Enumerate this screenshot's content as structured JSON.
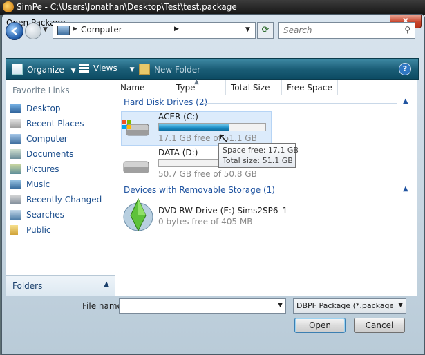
{
  "app": {
    "title": "SimPe - C:\\Users\\Jonathan\\Desktop\\Test\\test.package"
  },
  "dialog": {
    "title": "Open Package",
    "close_label": "x"
  },
  "address": {
    "path": "Computer",
    "search_placeholder": "Search"
  },
  "toolbar": {
    "organize": "Organize",
    "views": "Views",
    "new_folder": "New Folder",
    "help": "?"
  },
  "navpane": {
    "header": "Favorite Links",
    "items": [
      {
        "label": "Desktop",
        "icon": "desktop-icon"
      },
      {
        "label": "Recent Places",
        "icon": "recent-places-icon"
      },
      {
        "label": "Computer",
        "icon": "computer-icon"
      },
      {
        "label": "Documents",
        "icon": "documents-icon"
      },
      {
        "label": "Pictures",
        "icon": "pictures-icon"
      },
      {
        "label": "Music",
        "icon": "music-icon"
      },
      {
        "label": "Recently Changed",
        "icon": "recently-changed-icon"
      },
      {
        "label": "Searches",
        "icon": "searches-icon"
      },
      {
        "label": "Public",
        "icon": "public-folder-icon"
      }
    ],
    "folders": "Folders"
  },
  "columns": [
    "Name",
    "Type",
    "Total Size",
    "Free Space"
  ],
  "groups": {
    "hdd": "Hard Disk Drives (2)",
    "removable": "Devices with Removable Storage (1)"
  },
  "drives": [
    {
      "name": "ACER (C:)",
      "free_text": "17.1 GB free of 51.1 GB",
      "used_fraction": 0.665
    },
    {
      "name": "DATA (D:)",
      "free_text": "50.7 GB free of 50.8 GB",
      "used_fraction": 0.002
    },
    {
      "name": "DVD RW Drive (E:) Sims2SP6_1",
      "free_text": "0 bytes free of 405 MB"
    }
  ],
  "tooltip": {
    "space_free": "Space free: 17.1 GB",
    "total_size": "Total size: 51.1 GB"
  },
  "bottom": {
    "file_name_label": "File name:",
    "file_name_value": "",
    "file_type": "DBPF Package (*.package;*.",
    "open": "Open",
    "cancel": "Cancel"
  },
  "colors": {
    "toolbar": "#1b5e77",
    "link": "#1a4d8c",
    "bar_fill": "#1c8fc7"
  }
}
